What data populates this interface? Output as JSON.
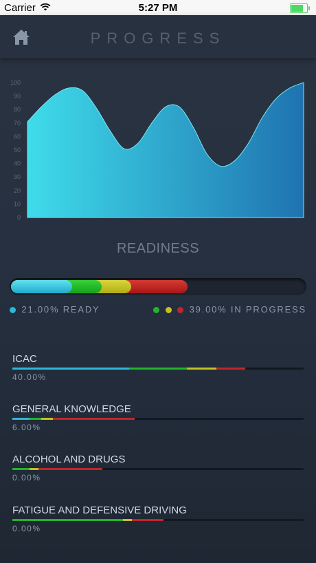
{
  "status_bar": {
    "carrier": "Carrier",
    "time": "5:27 PM",
    "battery_level": 0.75
  },
  "header": {
    "title": "PROGRESS",
    "home_icon": "home-icon"
  },
  "chart_data": {
    "type": "area",
    "x": [
      0,
      1,
      2,
      3,
      4,
      5,
      6,
      7,
      8,
      9,
      10,
      11,
      12,
      13,
      14,
      15,
      16,
      17,
      18,
      19,
      20
    ],
    "y": [
      71,
      82,
      91,
      96,
      94,
      81,
      64,
      51,
      55,
      70,
      82,
      82,
      67,
      47,
      38,
      42,
      55,
      74,
      88,
      96,
      100
    ],
    "yticks": [
      0,
      10,
      20,
      30,
      40,
      50,
      60,
      70,
      80,
      90,
      100
    ],
    "ylim": [
      0,
      100
    ],
    "grid": false,
    "fill_color_start": "#3fdcea",
    "fill_color_end": "#1f73b0"
  },
  "readiness": {
    "title": "READINESS",
    "segments": [
      {
        "color": "blue",
        "fraction": 0.21
      },
      {
        "color": "green",
        "fraction": 0.1
      },
      {
        "color": "yellow",
        "fraction": 0.1
      },
      {
        "color": "red",
        "fraction": 0.19
      }
    ],
    "ready_label": "21.00% READY",
    "progress_label": "39.00% IN PROGRESS"
  },
  "colors": {
    "blue": "#2fb7d6",
    "green": "#22b52a",
    "yellow": "#c4c221",
    "red": "#c0262a"
  },
  "modules": [
    {
      "name": "ICAC",
      "percent": "40.00%",
      "segments": [
        {
          "color": "blue",
          "fraction": 0.4
        },
        {
          "color": "green",
          "fraction": 0.2
        },
        {
          "color": "yellow",
          "fraction": 0.1
        },
        {
          "color": "red",
          "fraction": 0.1
        }
      ]
    },
    {
      "name": "GENERAL KNOWLEDGE",
      "percent": "6.00%",
      "segments": [
        {
          "color": "blue",
          "fraction": 0.06
        },
        {
          "color": "green",
          "fraction": 0.04
        },
        {
          "color": "yellow",
          "fraction": 0.04
        },
        {
          "color": "red",
          "fraction": 0.28
        }
      ]
    },
    {
      "name": "ALCOHOL AND DRUGS",
      "percent": "0.00%",
      "segments": [
        {
          "color": "blue",
          "fraction": 0.0
        },
        {
          "color": "green",
          "fraction": 0.06
        },
        {
          "color": "yellow",
          "fraction": 0.03
        },
        {
          "color": "red",
          "fraction": 0.22
        }
      ]
    },
    {
      "name": "FATIGUE AND DEFENSIVE DRIVING",
      "percent": "0.00%",
      "segments": [
        {
          "color": "blue",
          "fraction": 0.0
        },
        {
          "color": "green",
          "fraction": 0.38
        },
        {
          "color": "yellow",
          "fraction": 0.03
        },
        {
          "color": "red",
          "fraction": 0.11
        }
      ]
    }
  ]
}
